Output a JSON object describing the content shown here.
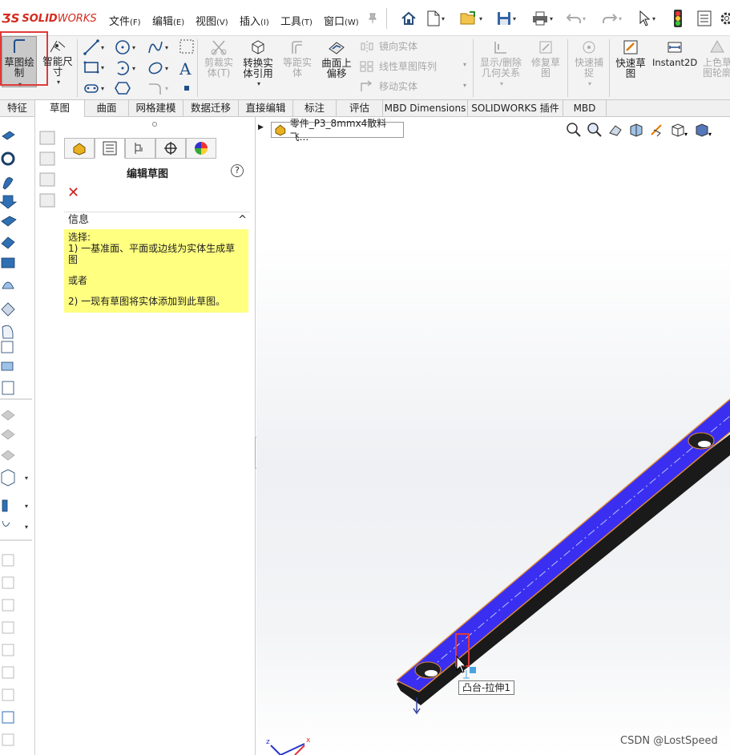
{
  "app": {
    "brand_prefix": "SOLID",
    "brand_suffix": "WORKS"
  },
  "menu": [
    {
      "label": "文件",
      "key": "(F)"
    },
    {
      "label": "编辑",
      "key": "(E)"
    },
    {
      "label": "视图",
      "key": "(V)"
    },
    {
      "label": "插入",
      "key": "(I)"
    },
    {
      "label": "工具",
      "key": "(T)"
    },
    {
      "label": "窗口",
      "key": "(W)"
    }
  ],
  "ribbon": {
    "sketch": "草图绘\n制",
    "smart_dim": "智能尺\n寸",
    "trim": "剪裁实\n体(T)",
    "convert": "转换实\n体引用",
    "offset": "等距实\n体",
    "offset_surface": "曲面上\n偏移",
    "mirror": "镜向实体",
    "linear_pattern": "线性草图阵列",
    "move": "移动实体",
    "display_relations": "显示/删除\n几何关系",
    "repair": "修复草\n图",
    "quick_snaps": "快速捕\n捉",
    "rapid_sketch": "快速草\n图",
    "instant2d": "Instant2D",
    "shaded_contours": "上色草\n图轮廓"
  },
  "tabs": [
    "特征",
    "草图",
    "曲面",
    "网格建模",
    "数据迁移",
    "直接编辑",
    "标注",
    "评估",
    "MBD Dimensions",
    "SOLIDWORKS 插件",
    "MBD"
  ],
  "active_tab": "草图",
  "pm": {
    "title": "编辑草图",
    "help": "?",
    "close": "✕",
    "info_header": "信息",
    "info_lines": [
      "选择:",
      "1) 一基准面、平面或边线为实体生成草图",
      "或者",
      "2) 一现有草图将实体添加到此草图。"
    ]
  },
  "viewport": {
    "part_name": "零件_P3_8mmx4散料飞...",
    "tooltip": "凸台-拉伸1",
    "watermark": "CSDN @LostSpeed",
    "axis_x": "x",
    "axis_z": "z"
  },
  "colors": {
    "accent_red": "#e03a3a",
    "face_blue": "#3a2ff0",
    "info_yellow": "#ffff80"
  }
}
